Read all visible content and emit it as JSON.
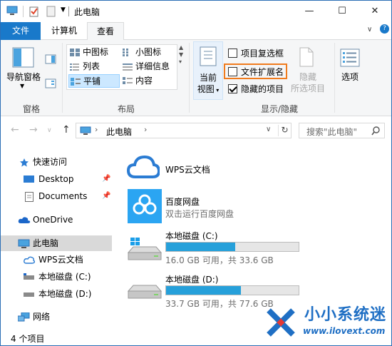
{
  "window": {
    "title": "此电脑",
    "controls": {
      "minimize": "—",
      "maximize": "☐",
      "close": "✕"
    }
  },
  "ribbon_tabs": [
    {
      "label": "文件"
    },
    {
      "label": "计算机"
    },
    {
      "label": "查看"
    }
  ],
  "ribbon": {
    "pane_group": {
      "nav_pane_label": "导航窗格",
      "group_label": "窗格"
    },
    "layout_group": {
      "items": [
        "中图标",
        "小图标",
        "列表",
        "详细信息",
        "平铺",
        "内容"
      ],
      "selected": "平铺",
      "group_label": "布局"
    },
    "current_view": {
      "label_line1": "当前",
      "label_line2": "视图"
    },
    "show_hide_group": {
      "checkboxes": [
        {
          "label": "项目复选框",
          "checked": false
        },
        {
          "label": "文件扩展名",
          "checked": false
        },
        {
          "label": "隐藏的项目",
          "checked": true
        }
      ],
      "hide_selected_line1": "隐藏",
      "hide_selected_line2": "所选项目",
      "options_label": "选项",
      "group_label": "显示/隐藏"
    }
  },
  "address": {
    "path": "此电脑",
    "search_placeholder": "搜索\"此电脑\""
  },
  "sidebar": {
    "items": [
      {
        "label": "快速访问",
        "icon": "star-icon"
      },
      {
        "label": "Desktop",
        "icon": "desktop-icon",
        "pinned": true
      },
      {
        "label": "Documents",
        "icon": "document-icon",
        "pinned": true
      },
      {
        "label": "OneDrive",
        "icon": "cloud-icon"
      },
      {
        "label": "此电脑",
        "icon": "computer-icon",
        "selected": true
      },
      {
        "label": "WPS云文档",
        "icon": "cloud-outline-icon"
      },
      {
        "label": "本地磁盘 (C:)",
        "icon": "drive-icon"
      },
      {
        "label": "本地磁盘 (D:)",
        "icon": "drive-icon"
      },
      {
        "label": "网络",
        "icon": "network-icon"
      }
    ]
  },
  "main": {
    "items": [
      {
        "name": "WPS云文档",
        "icon": "wps-cloud-icon"
      },
      {
        "name": "百度网盘",
        "subtitle": "双击运行百度网盘",
        "icon": "baidu-netdisk-icon"
      }
    ],
    "drives": [
      {
        "name": "本地磁盘 (C:)",
        "space": "16.0 GB 可用，共 33.6 GB",
        "used_fraction": 0.524
      },
      {
        "name": "本地磁盘 (D:)",
        "space": "33.7 GB 可用，共 77.6 GB",
        "used_fraction": 0.566
      }
    ]
  },
  "status": {
    "count": "4 个项目"
  },
  "watermark": {
    "title": "小小系统迷",
    "url": "www.ilovext.com"
  },
  "colors": {
    "accent": "#1979ca",
    "highlight_box": "#f07b1d",
    "drive_fill": "#26a0da"
  }
}
